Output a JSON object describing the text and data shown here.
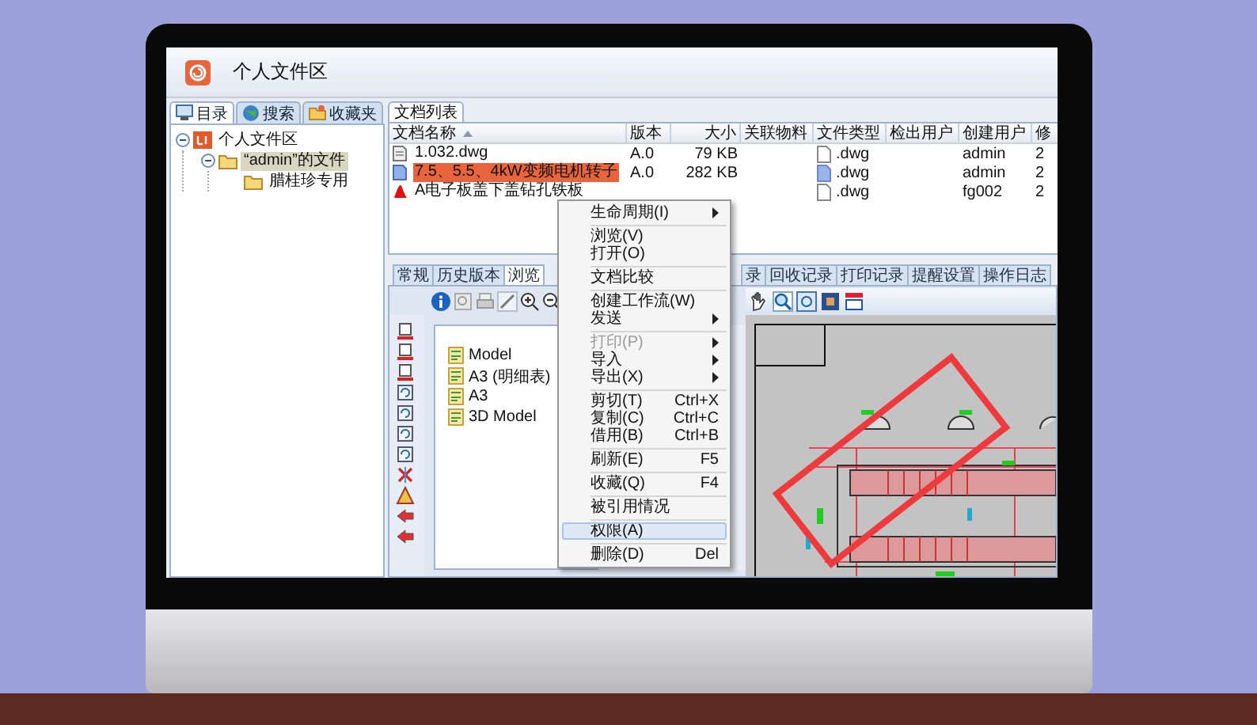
{
  "window": {
    "title": "个人文件区"
  },
  "left_tabs": [
    {
      "label": "目录",
      "kind": "catalog",
      "selected": true
    },
    {
      "label": "搜索",
      "kind": "search",
      "selected": false
    },
    {
      "label": "收藏夹",
      "kind": "favorites",
      "selected": false
    }
  ],
  "tree": [
    {
      "label": "个人文件区",
      "kind": "root",
      "expanded": true,
      "selected": false,
      "children": [
        {
          "label": "“admin”的文件",
          "kind": "folder",
          "expanded": true,
          "selected": true,
          "children": [
            {
              "label": "腊桂珍专用",
              "kind": "folder",
              "selected": false
            }
          ]
        }
      ]
    }
  ],
  "document_list": {
    "tab": "文档列表",
    "columns": [
      "文档名称",
      "版本",
      "大小",
      "关联物料",
      "文件类型",
      "检出用户",
      "创建用户",
      "修"
    ],
    "rows": [
      {
        "kind": "dwg",
        "selected": false,
        "name": "1.032.dwg",
        "version": "A.0",
        "size": "79 KB",
        "file_type": ".dwg",
        "created_by": "admin",
        "column_8": "2"
      },
      {
        "kind": "preview",
        "selected": true,
        "name": "7.5、5.5、4kW变频电机转子",
        "version": "A.0",
        "size": "282 KB",
        "file_type": ".dwg",
        "created_by": "admin",
        "column_8": "2"
      },
      {
        "kind": "pdf",
        "selected": false,
        "name": "A电子板盖下盖钻孔铁板",
        "file_type": ".dwg",
        "created_by": "fg002",
        "column_8": "2"
      }
    ]
  },
  "detail_tabs": [
    {
      "label": "常规",
      "kind": "full",
      "selected": false
    },
    {
      "label": "历史版本",
      "kind": "full",
      "selected": false
    },
    {
      "label": "浏览",
      "kind": "full",
      "selected": true
    },
    {
      "label": "录",
      "kind": "partial",
      "selected": false
    },
    {
      "label": "回收记录",
      "kind": "full",
      "selected": false
    },
    {
      "label": "打印记录",
      "kind": "full",
      "selected": false
    },
    {
      "label": "提醒设置",
      "kind": "full",
      "selected": false
    },
    {
      "label": "操作日志",
      "kind": "full",
      "selected": false
    }
  ],
  "layouts": [
    {
      "label": "Model"
    },
    {
      "label": "A3 (明细表)"
    },
    {
      "label": "A3"
    },
    {
      "label": "3D Model"
    }
  ],
  "context_menu": {
    "groups": [
      [
        {
          "label": "生命周期(I)",
          "submenu": true,
          "disabled": false,
          "selected": false
        }
      ],
      [
        {
          "label": "浏览(V)",
          "submenu": false,
          "disabled": false,
          "selected": false
        },
        {
          "label": "打开(O)",
          "submenu": false,
          "disabled": false,
          "selected": false
        }
      ],
      [
        {
          "label": "文档比较",
          "submenu": false,
          "disabled": false,
          "selected": false
        }
      ],
      [
        {
          "label": "创建工作流(W)",
          "submenu": false,
          "disabled": false,
          "selected": false
        },
        {
          "label": "发送",
          "submenu": true,
          "disabled": false,
          "selected": false
        }
      ],
      [
        {
          "label": "打印(P)",
          "submenu": true,
          "disabled": true,
          "selected": false
        },
        {
          "label": "导入",
          "submenu": true,
          "disabled": false,
          "selected": false
        },
        {
          "label": "导出(X)",
          "submenu": true,
          "disabled": false,
          "selected": false
        }
      ],
      [
        {
          "label": "剪切(T)",
          "shortcut": "Ctrl+X",
          "submenu": false,
          "disabled": false,
          "selected": false
        },
        {
          "label": "复制(C)",
          "shortcut": "Ctrl+C",
          "submenu": false,
          "disabled": false,
          "selected": false
        },
        {
          "label": "借用(B)",
          "shortcut": "Ctrl+B",
          "submenu": false,
          "disabled": false,
          "selected": false
        }
      ],
      [
        {
          "label": "刷新(E)",
          "shortcut": "F5",
          "submenu": false,
          "disabled": false,
          "selected": false
        }
      ],
      [
        {
          "label": "收藏(Q)",
          "shortcut": "F4",
          "submenu": false,
          "disabled": false,
          "selected": false
        }
      ],
      [
        {
          "label": "被引用情况",
          "submenu": false,
          "disabled": false,
          "selected": false
        }
      ],
      [
        {
          "label": "权限(A)",
          "submenu": false,
          "disabled": false,
          "selected": true
        }
      ],
      [
        {
          "label": "删除(D)",
          "shortcut": "Del",
          "submenu": false,
          "disabled": false,
          "selected": false
        }
      ]
    ]
  }
}
